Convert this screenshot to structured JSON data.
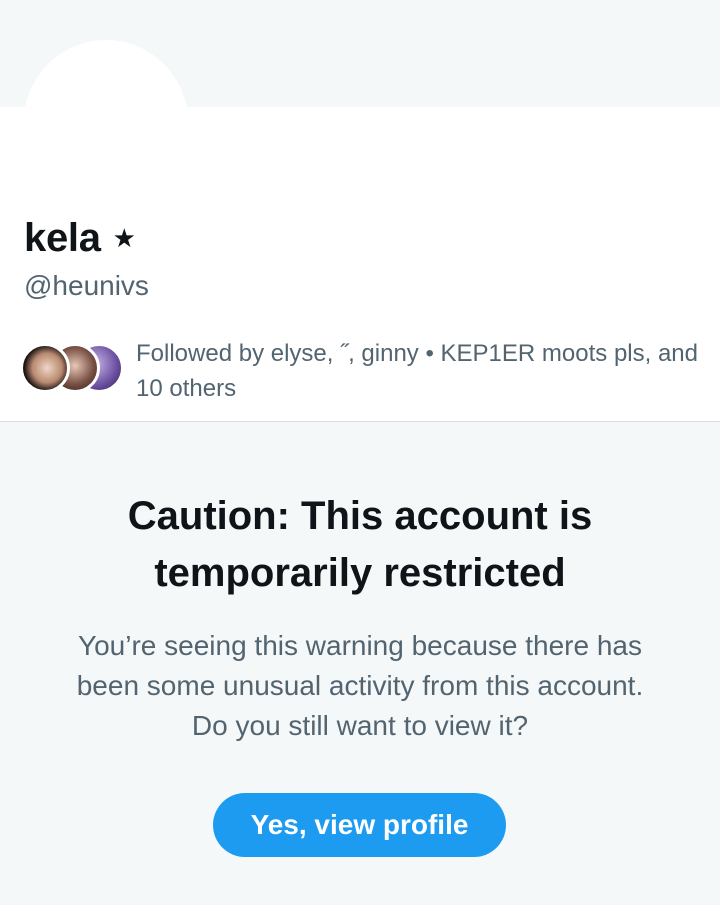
{
  "profile": {
    "display_name": "kela",
    "badge_glyph": "★",
    "handle": "@heunivs"
  },
  "followers": {
    "text": "Followed by elyse, ˝, ginny • KEP1ER moots pls, and 10 others",
    "avatars": [
      "follower-avatar",
      "follower-avatar",
      "follower-avatar"
    ]
  },
  "warning": {
    "title": "Caution: This account is temporarily restricted",
    "body": "You’re seeing this warning because there has been some unusual activity from this account. Do you still want to view it?",
    "button_label": "Yes, view profile"
  },
  "colors": {
    "accent": "#1d9bf0",
    "text_primary": "#0f1419",
    "text_secondary": "#536471",
    "background_muted": "#f5f8f8"
  }
}
